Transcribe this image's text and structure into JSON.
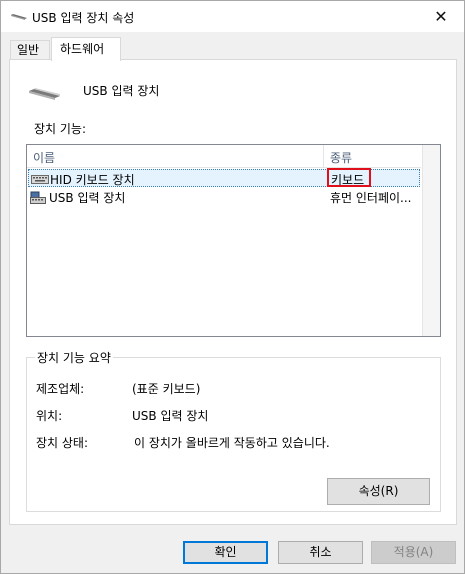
{
  "window": {
    "title": "USB 입력 장치 속성",
    "close_icon": "close-icon"
  },
  "tabs": [
    {
      "label": "일반"
    },
    {
      "label": "하드웨어"
    }
  ],
  "device": {
    "name": "USB 입력 장치",
    "icon": "usb-device-icon"
  },
  "functions": {
    "label": "장치 기능:",
    "columns": [
      "이름",
      "종류"
    ],
    "rows": [
      {
        "name": "HID 키보드 장치",
        "type": "키보드",
        "icon": "keyboard-icon"
      },
      {
        "name": "USB 입력 장치",
        "type": "휴먼 인터페이...",
        "icon": "hid-device-icon"
      }
    ]
  },
  "summary": {
    "legend": "장치 기능 요약",
    "manufacturer_label": "제조업체:",
    "manufacturer_value": "(표준 키보드)",
    "location_label": "위치:",
    "location_value": "USB 입력 장치",
    "status_label": "장치 상태:",
    "status_value": "이 장치가 올바르게 작동하고 있습니다."
  },
  "buttons": {
    "properties": "속성(R)",
    "ok": "확인",
    "cancel": "취소",
    "apply": "적용(A)"
  }
}
